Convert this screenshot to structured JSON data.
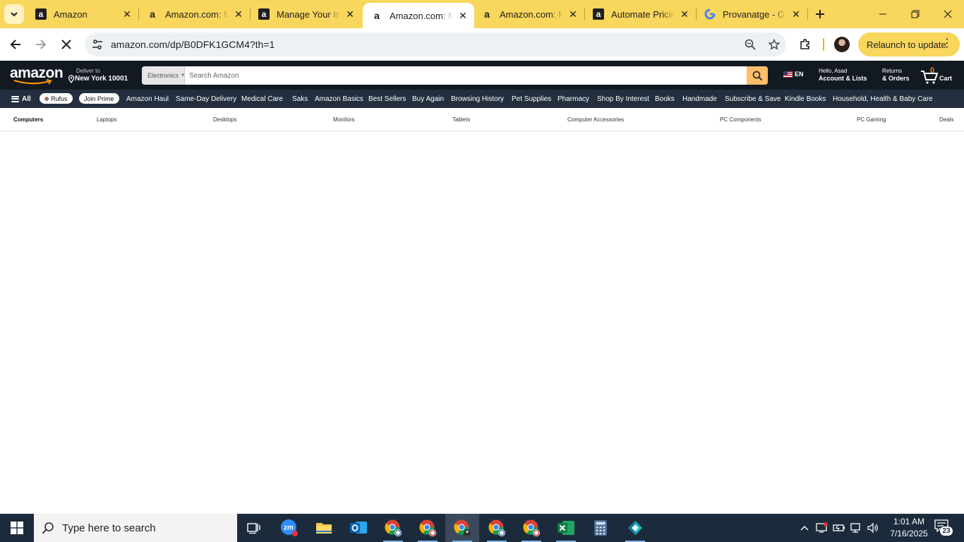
{
  "browser": {
    "tabs": [
      {
        "title": "Amazon",
        "favicon": "amazon-favicon"
      },
      {
        "title": "Amazon.com: Ma",
        "favicon": "amazon-favicon"
      },
      {
        "title": "Manage Your Inv",
        "favicon": "amazon-favicon"
      },
      {
        "title": "Amazon.com: Ma",
        "favicon": "amazon-favicon",
        "active": true
      },
      {
        "title": "Amazon.com: Ma",
        "favicon": "amazon-favicon"
      },
      {
        "title": "Automate Pricing",
        "favicon": "amazon-favicon"
      },
      {
        "title": "Provanatge - Go",
        "favicon": "google-favicon"
      }
    ],
    "url": "amazon.com/dp/B0DFK1GCM4?th=1",
    "relaunch_label": "Relaunch to update"
  },
  "amazon": {
    "logo": "amazon",
    "deliver_line1": "Deliver to",
    "deliver_line2": "New York 10001",
    "search_category": "Electronics",
    "search_placeholder": "Search Amazon",
    "language": "EN",
    "account_line1": "Hello, Asad",
    "account_line2": "Account & Lists",
    "orders_line1": "Returns",
    "orders_line2": "& Orders",
    "cart_count": "0",
    "cart_label": "Cart",
    "nav": {
      "all": "All",
      "rufus": "Rufus",
      "join_prime": "Join Prime",
      "items": [
        "Amazon Haul",
        "Same-Day Delivery",
        "Medical Care",
        "Saks",
        "Amazon Basics",
        "Best Sellers",
        "Buy Again",
        "Browsing History",
        "Pet Supplies",
        "Pharmacy",
        "Shop By Interest",
        "Books",
        "Handmade",
        "Subscribe & Save",
        "Kindle Books",
        "Household, Health & Baby Care"
      ]
    },
    "subnav": [
      "Computers",
      "Laptops",
      "Desktops",
      "Monitors",
      "Tablets",
      "Computer Accessories",
      "PC Components",
      "PC Gaming",
      "Deals"
    ]
  },
  "taskbar": {
    "search_placeholder": "Type here to search",
    "time": "1:01 AM",
    "date": "7/16/2025",
    "notification_count": "23"
  },
  "colors": {
    "tabstrip": "#f9d65c",
    "amazon_dark": "#131921",
    "amazon_nav": "#232f3e",
    "amazon_search_button": "#febd69",
    "taskbar": "#1c2b3c"
  }
}
